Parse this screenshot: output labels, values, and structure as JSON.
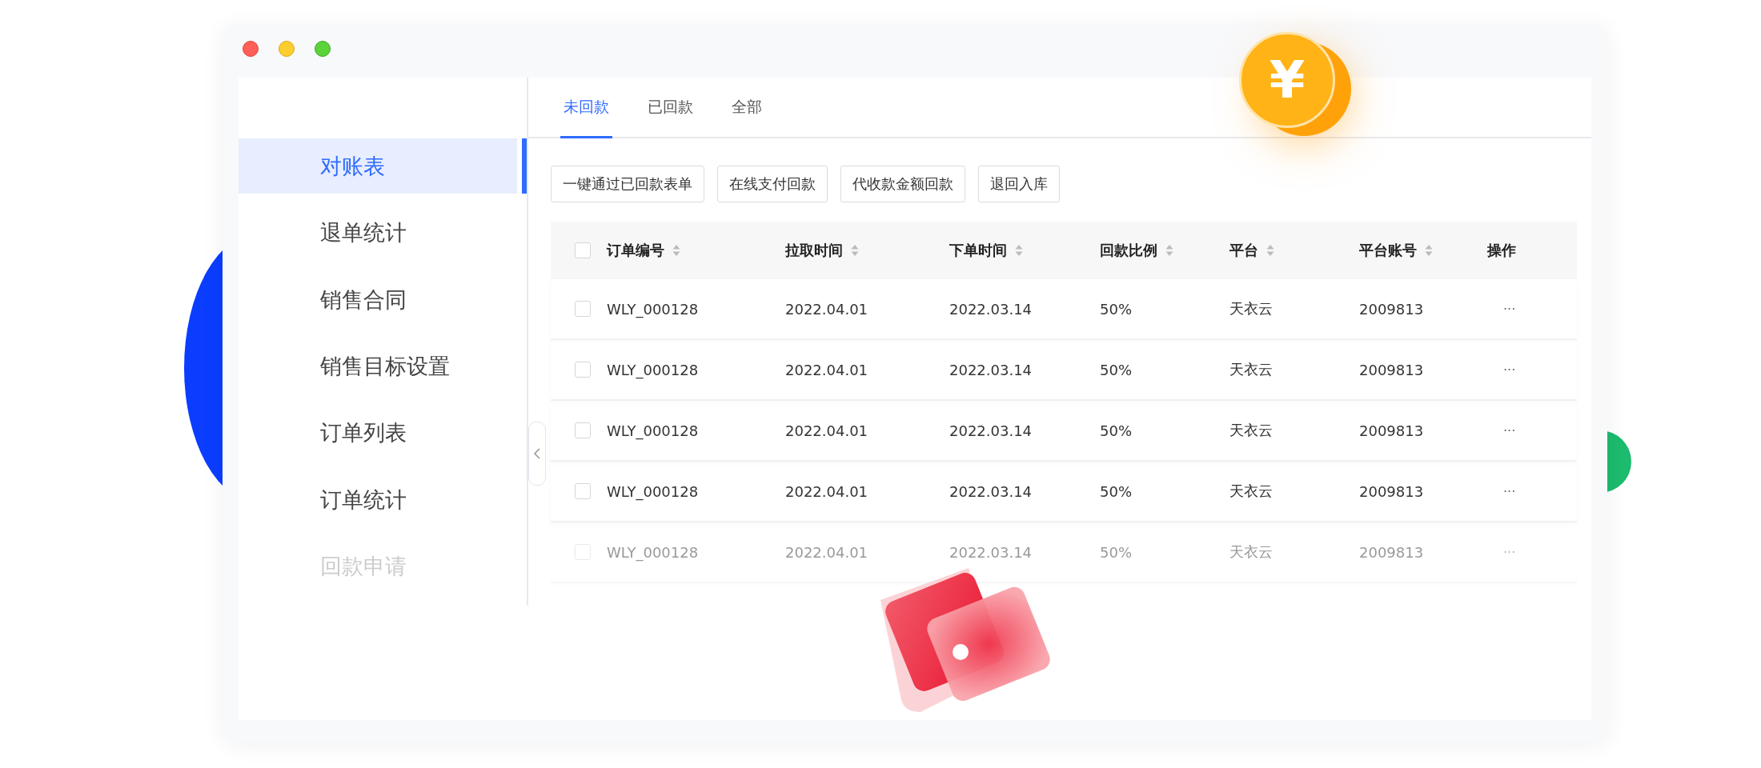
{
  "sidebar": {
    "items": [
      {
        "label": "对账表",
        "selected": true
      },
      {
        "label": "退单统计",
        "selected": false
      },
      {
        "label": "销售合同",
        "selected": false
      },
      {
        "label": "销售目标设置",
        "selected": false
      },
      {
        "label": "订单列表",
        "selected": false
      },
      {
        "label": "订单统计",
        "selected": false
      },
      {
        "label": "回款申请",
        "selected": false
      }
    ]
  },
  "tabs": [
    {
      "label": "未回款",
      "selected": true
    },
    {
      "label": "已回款",
      "selected": false
    },
    {
      "label": "全部",
      "selected": false
    }
  ],
  "toolbar": {
    "buttons": [
      "一键通过已回款表单",
      "在线支付回款",
      "代收款金额回款",
      "退回入库"
    ]
  },
  "table": {
    "header_checked": false,
    "columns": [
      {
        "label": "订单编号",
        "sortable": true
      },
      {
        "label": "拉取时间",
        "sortable": true
      },
      {
        "label": "下单时间",
        "sortable": true
      },
      {
        "label": "回款比例",
        "sortable": true
      },
      {
        "label": "平台",
        "sortable": true
      },
      {
        "label": "平台账号",
        "sortable": true
      },
      {
        "label": "操作",
        "sortable": false
      }
    ],
    "rows": [
      {
        "checked": false,
        "cells": [
          "WLY_000128",
          "2022.04.01",
          "2022.03.14",
          "50%",
          "天衣云",
          "2009813",
          "···"
        ]
      },
      {
        "checked": false,
        "cells": [
          "WLY_000128",
          "2022.04.01",
          "2022.03.14",
          "50%",
          "天衣云",
          "2009813",
          "···"
        ]
      },
      {
        "checked": false,
        "cells": [
          "WLY_000128",
          "2022.04.01",
          "2022.03.14",
          "50%",
          "天衣云",
          "2009813",
          "···"
        ]
      },
      {
        "checked": false,
        "cells": [
          "WLY_000128",
          "2022.04.01",
          "2022.03.14",
          "50%",
          "天衣云",
          "2009813",
          "···"
        ]
      },
      {
        "checked": false,
        "cells": [
          "WLY_000128",
          "2022.04.01",
          "2022.03.14",
          "50%",
          "天衣云",
          "2009813",
          "···"
        ]
      }
    ]
  },
  "coin": {
    "symbol": "¥"
  }
}
